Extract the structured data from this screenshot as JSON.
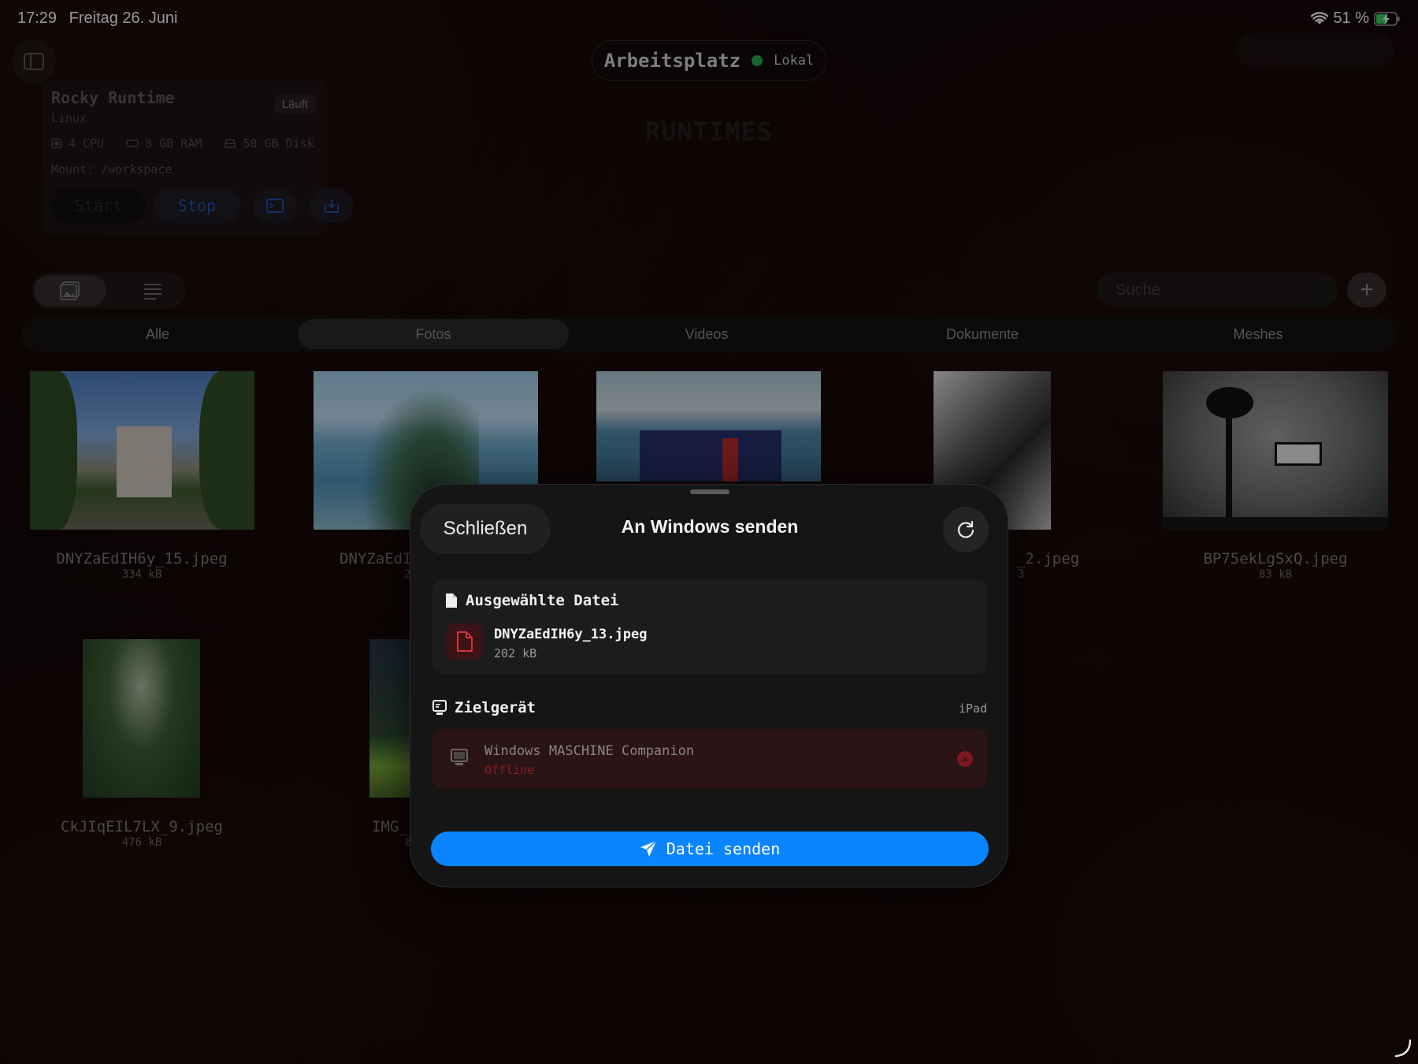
{
  "status_bar": {
    "time": "17:29",
    "date": "Freitag 26. Juni",
    "battery": "51 %"
  },
  "workspace": {
    "title": "Arbeitsplatz",
    "status": "Lokal",
    "status_color": "#1fa34a"
  },
  "section_heading": "RUNTIMES",
  "runtime": {
    "name": "Rocky Runtime",
    "os": "Linux",
    "badge": "Läuft",
    "cpu": "4 CPU",
    "ram": "8 GB RAM",
    "disk": "50 GB Disk",
    "mount": "Mount: /workspace",
    "start_label": "Start",
    "stop_label": "Stop"
  },
  "search": {
    "placeholder": "Suche"
  },
  "tabs": [
    "Alle",
    "Fotos",
    "Videos",
    "Dokumente",
    "Meshes"
  ],
  "active_tab": "Fotos",
  "files": [
    {
      "name": "DNYZaEdIH6y_15.jpeg",
      "size": "334 kB"
    },
    {
      "name": "DNYZaEdI",
      "size": "2"
    },
    {
      "name": "_2.jpeg",
      "size": "3"
    },
    {
      "name": "BP75ekLgSxQ.jpeg",
      "size": "83 kB"
    },
    {
      "name": "CkJIqEIL7LX_9.jpeg",
      "size": "476 kB"
    },
    {
      "name": "IMG_",
      "size": "8"
    }
  ],
  "sheet": {
    "close_label": "Schließen",
    "title": "An Windows senden",
    "selected_file_header": "Ausgewählte Datei",
    "selected_file_name": "DNYZaEdIH6y_13.jpeg",
    "selected_file_size": "202 kB",
    "target_header": "Zielgerät",
    "target_current_device": "iPad",
    "device_name": "Windows MASCHINE Companion",
    "device_status": "Offline",
    "send_label": "Datei senden",
    "accent": "#0a84ff"
  }
}
